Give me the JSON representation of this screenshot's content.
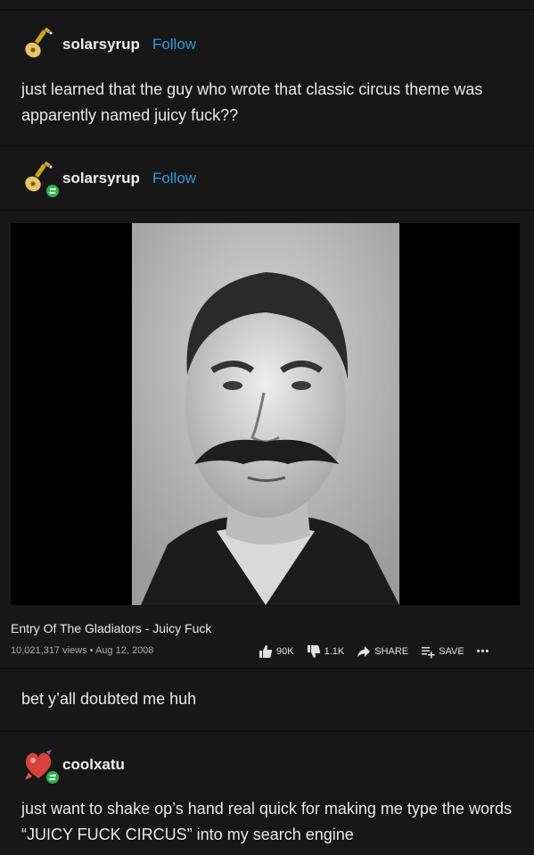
{
  "posts": [
    {
      "username": "solarsyrup",
      "follow": "Follow",
      "text": "just learned that the guy who wrote that classic circus theme was apparently named juicy fuck??"
    },
    {
      "username": "solarsyrup",
      "follow": "Follow",
      "text": "bet y’all doubted me huh"
    },
    {
      "username": "coolxatu",
      "text": "just want to shake op’s hand real quick for making me type the words “JUICY FUCK CIRCUS” into my search engine"
    }
  ],
  "video": {
    "title": "Entry Of The Gladiators - Juicy Fuck",
    "meta": "10,021,317 views • Aug 12, 2008",
    "likes": "90K",
    "dislikes": "1.1K",
    "share": "SHARE",
    "save": "SAVE",
    "more": "•••"
  },
  "icons": {
    "avatar1": "guitar-avatar-icon",
    "avatar2": "guitar-avatar-icon",
    "avatar3": "heart-avatar-icon",
    "reblog": "reblog-icon",
    "like": "thumbs-up-icon",
    "dislike": "thumbs-down-icon",
    "share": "share-arrow-icon",
    "save": "playlist-add-icon"
  },
  "colors": {
    "background": "#171717",
    "follow": "#2f9bd9",
    "reblog": "#2bb24c"
  }
}
